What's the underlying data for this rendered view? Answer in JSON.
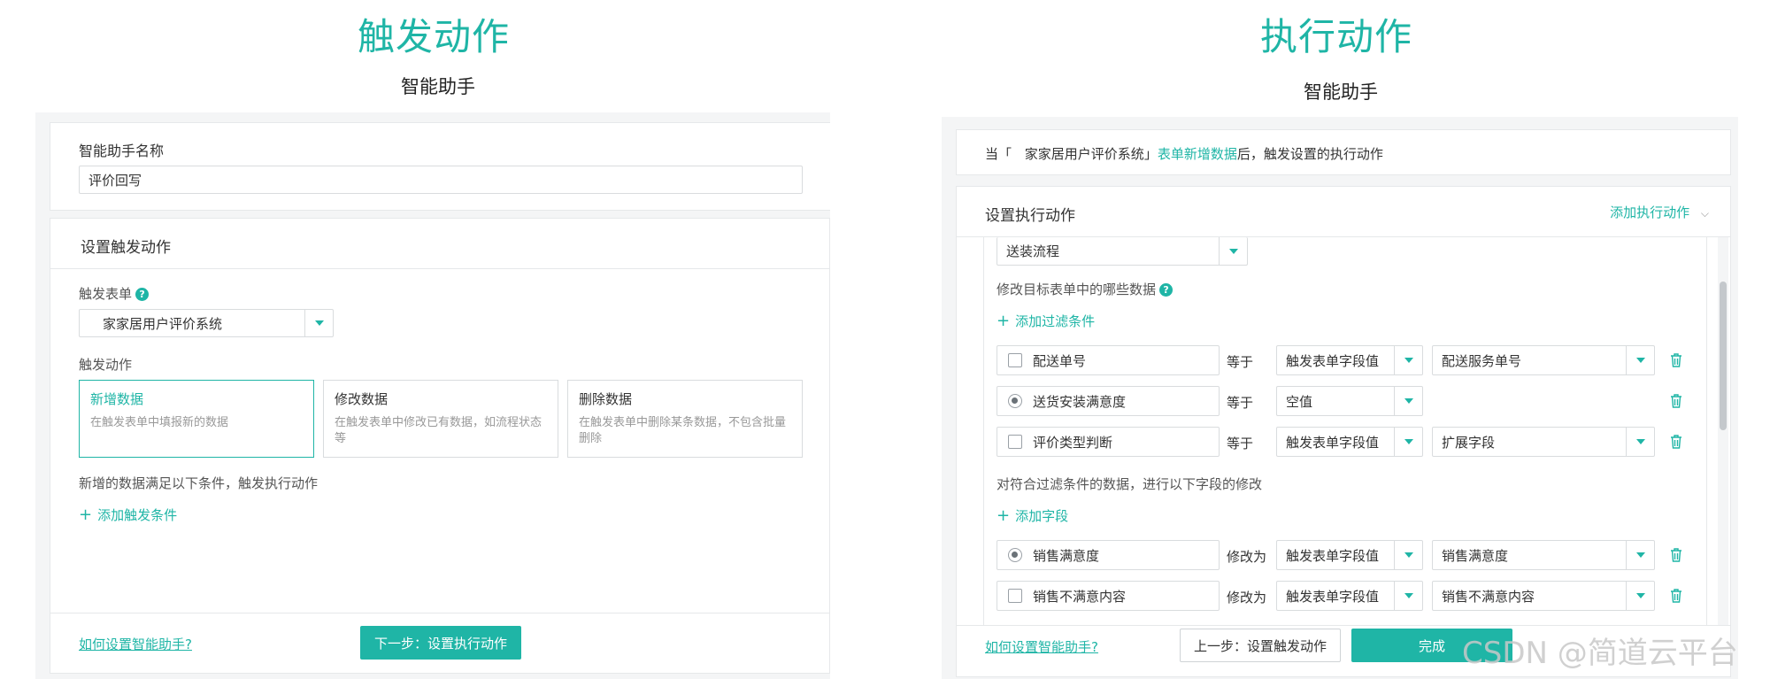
{
  "left": {
    "big_title": "触发动作",
    "sub_title": "智能助手",
    "name_label": "智能助手名称",
    "name_value": "评价回写",
    "section_title": "设置触发动作",
    "form_label": "触发表单",
    "form_value": "家家居用户评价系统",
    "action_label": "触发动作",
    "options": [
      {
        "title": "新增数据",
        "desc": "在触发表单中填报新的数据"
      },
      {
        "title": "修改数据",
        "desc": "在触发表单中修改已有数据，如流程状态等"
      },
      {
        "title": "删除数据",
        "desc": "在触发表单中删除某条数据，不包含批量删除"
      }
    ],
    "condition_text": "新增的数据满足以下条件，触发执行动作",
    "add_condition": "添加触发条件",
    "help_link": "如何设置智能助手?",
    "next_button": "下一步：设置执行动作"
  },
  "right": {
    "big_title": "执行动作",
    "sub_title": "智能助手",
    "info_prefix": "当「",
    "info_form": "家家居用户评价系统」",
    "info_event": "表单新增数据",
    "info_suffix": "后，触发设置的执行动作",
    "section_title": "设置执行动作",
    "add_action": "添加执行动作",
    "target_value": "送装流程",
    "filter_label": "修改目标表单中的哪些数据",
    "add_filter": "添加过滤条件",
    "filters": [
      {
        "field": "配送单号",
        "op": "等于",
        "mode": "触发表单字段值",
        "value": "配送服务单号"
      },
      {
        "field": "送货安装满意度",
        "op": "等于",
        "mode": "空值",
        "value": ""
      },
      {
        "field": "评价类型判断",
        "op": "等于",
        "mode": "触发表单字段值",
        "value": "扩展字段"
      }
    ],
    "modify_label": "对符合过滤条件的数据，进行以下字段的修改",
    "add_field": "添加字段",
    "modifications": [
      {
        "field": "销售满意度",
        "op": "修改为",
        "mode": "触发表单字段值",
        "value": "销售满意度"
      },
      {
        "field": "销售不满意内容",
        "op": "修改为",
        "mode": "触发表单字段值",
        "value": "销售不满意内容"
      }
    ],
    "help_link": "如何设置智能助手?",
    "prev_button": "上一步：设置触发动作",
    "done_button": "完成"
  },
  "watermark": "CSDN @简道云平台",
  "colors": {
    "accent": "#1fb5a6"
  }
}
